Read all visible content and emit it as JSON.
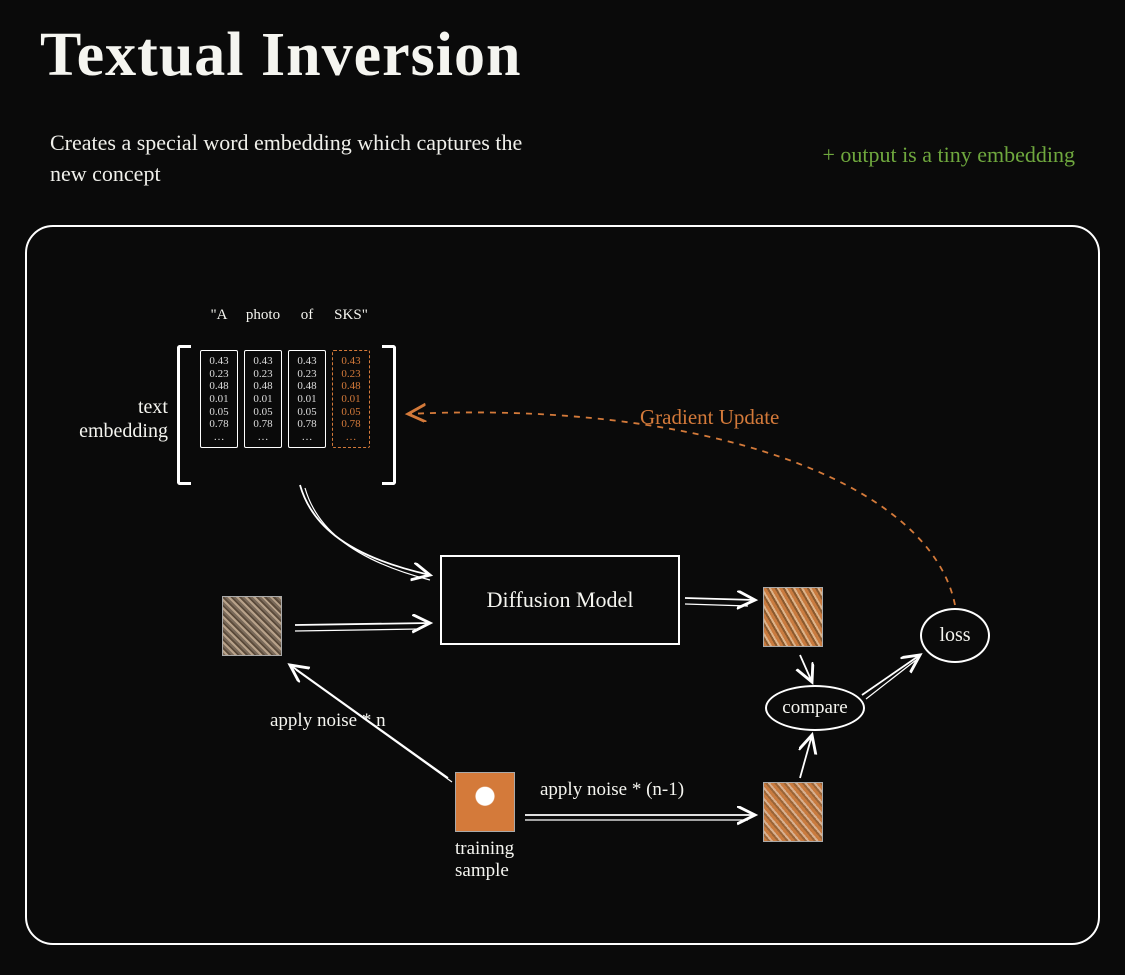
{
  "title": "Textual Inversion",
  "subtitle": "Creates a special word embedding which captures the new concept",
  "note": "+ output is a tiny embedding",
  "embedding": {
    "label": "text embedding",
    "tokens": [
      "\"A",
      "photo",
      "of",
      "SKS\""
    ],
    "values": [
      "0.43",
      "0.23",
      "0.48",
      "0.01",
      "0.05",
      "0.78",
      "…"
    ]
  },
  "diffusion_label": "Diffusion Model",
  "compare_label": "compare",
  "loss_label": "loss",
  "apply_noise_n": "apply noise * n",
  "apply_noise_n1": "apply noise * (n-1)",
  "training_sample": "training\nsample",
  "gradient_update": "Gradient Update"
}
